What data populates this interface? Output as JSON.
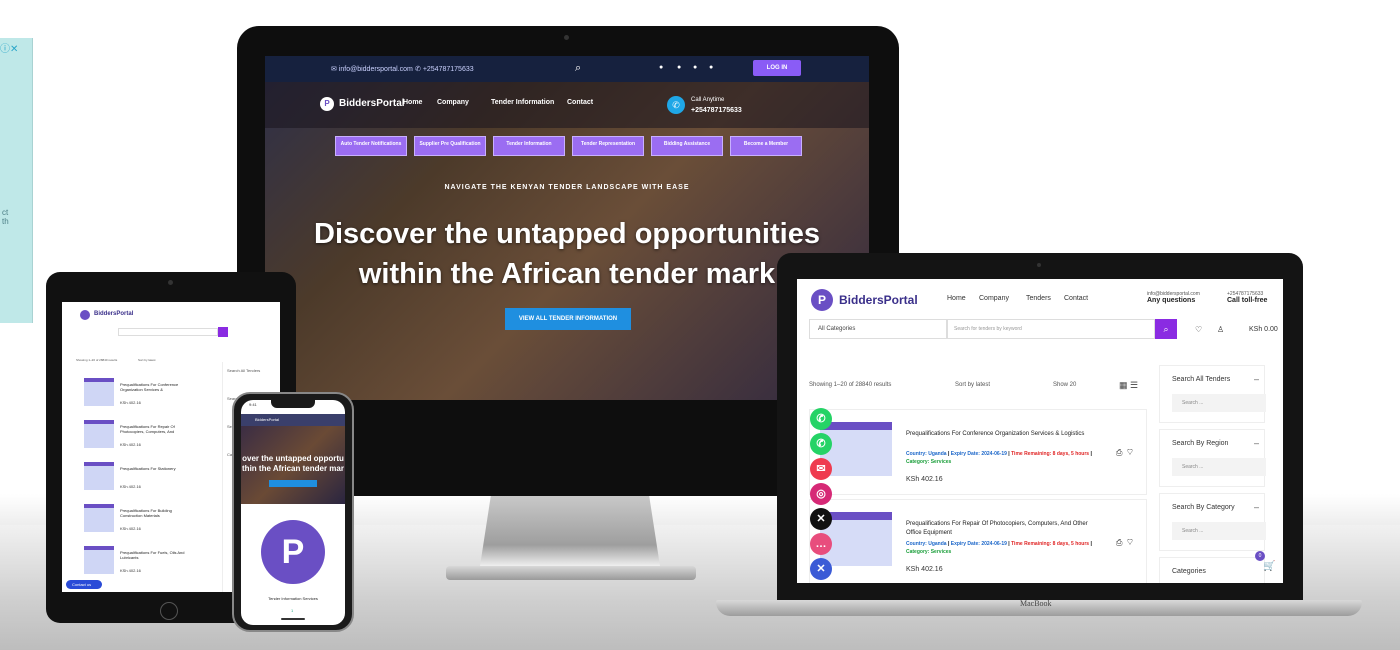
{
  "imac": {
    "top_email": "info@biddersportal.com",
    "top_phone": "+254787175633",
    "login": "LOG IN",
    "logo": "BiddersPortal",
    "menu": [
      "Home",
      "Company",
      "Tender Information",
      "Contact"
    ],
    "call_label": "Call Anytime",
    "call_number": "+254787175633",
    "services": [
      "Auto Tender Notifications",
      "Supplier Pre Qualification",
      "Tender Information",
      "Tender Representation",
      "Bidding Assistance",
      "Become a Member"
    ],
    "hero_sub": "NAVIGATE THE KENYAN TENDER LANDSCAPE WITH EASE",
    "hero_line1": "Discover the untapped opportunities",
    "hero_line2": "within the African tender mark",
    "hero_button": "VIEW ALL TENDER INFORMATION"
  },
  "macbook": {
    "logo": "BiddersPortal",
    "menu": [
      "Home",
      "Company",
      "Tenders",
      "Contact"
    ],
    "info_email": "info@biddersportal.com",
    "info_label": "Any questions",
    "phone_number": "+254787175633",
    "phone_label": "Call toll-free",
    "category_select": "All Categories",
    "search_placeholder": "Search for tenders by keyword",
    "cart": "KSh 0.00",
    "cart_count": "0",
    "showing": "Showing 1–20 of 28840 results",
    "sort": "Sort by latest",
    "show": "Show 20",
    "rows": [
      {
        "title": "Prequalifications For Conference Organization Services & Logistics",
        "country": "Country: Uganda",
        "expiry": "Expiry Date: 2024-06-19",
        "remaining": "Time Remaining: 8 days, 5 hours",
        "category": "Category: Services",
        "price": "KSh 402.16"
      },
      {
        "title": "Prequalifications For Repair Of Photocopiers, Computers, And Other Office Equipment",
        "country": "Country: Uganda",
        "expiry": "Expiry Date: 2024-06-19",
        "remaining": "Time Remaining: 8 days, 5 hours",
        "category": "Category: Services",
        "price": "KSh 402.16"
      }
    ],
    "sidebar": [
      {
        "heading": "Search All Tenders",
        "placeholder": "Search ..."
      },
      {
        "heading": "Search By Region",
        "placeholder": "Search ..."
      },
      {
        "heading": "Search By Category",
        "placeholder": "Search ..."
      }
    ],
    "categories_heading": "Categories",
    "brand": "MacBook"
  },
  "tablet": {
    "logo": "BiddersPortal",
    "showing": "Showing 1–20 of 28840 results",
    "sort": "Sort by latest",
    "footer": "Contact us",
    "sidebar": [
      "Search All Tenders",
      "Search By Region",
      "Search By Category",
      "Categories"
    ],
    "items": [
      {
        "title": "Prequalifications For Conference Organization Services &",
        "price": "KSh 402.16"
      },
      {
        "title": "Prequalifications For Repair Of Photocopiers, Computers, And",
        "price": "KSh 402.16"
      },
      {
        "title": "Prequalifications For Stationery",
        "price": "KSh 402.16"
      },
      {
        "title": "Prequalifications For Building Construction Materials",
        "price": "KSh 402.16"
      },
      {
        "title": "Prequalifications For Fuels, Oils And Lubricants",
        "price": "KSh 402.16"
      }
    ]
  },
  "phone": {
    "time": "9:41",
    "logo": "BiddersPortal",
    "hero": "over the untapped opportu\nthin the African tender mar",
    "label": "Tender Information Services",
    "dot": "1"
  },
  "ad": {
    "badge": "ⓘ✕",
    "text": "ct\nth"
  },
  "colors": {
    "brand": "#6a4fc4",
    "accent": "#8a2be2",
    "button": "#1f8fe0"
  },
  "floating_icons": [
    "phone-icon",
    "whatsapp-icon",
    "email-icon",
    "instagram-icon",
    "x-icon",
    "chat-icon",
    "close-icon"
  ]
}
